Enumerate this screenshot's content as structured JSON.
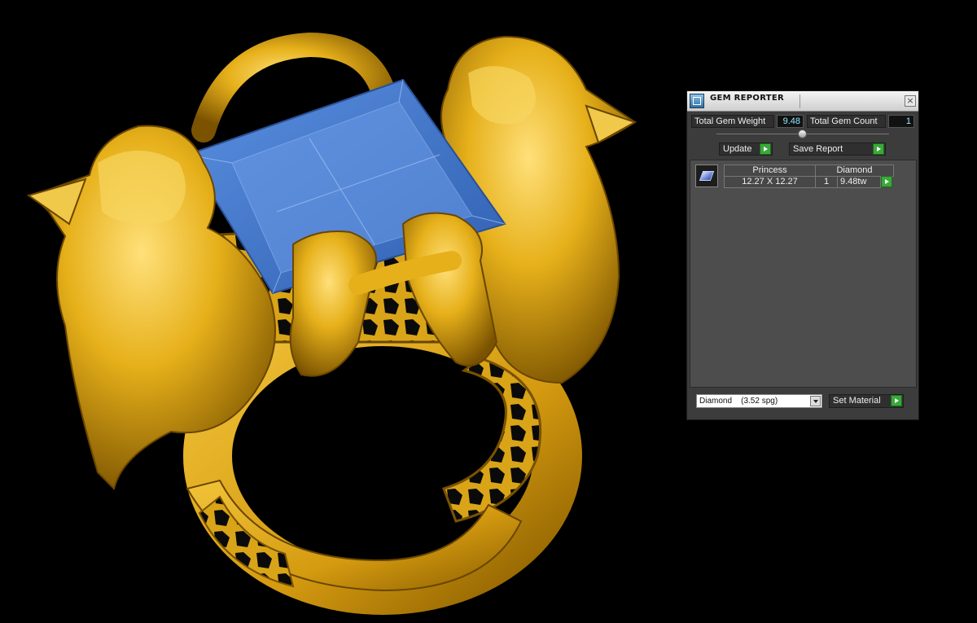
{
  "panel": {
    "title": "GEM REPORTER",
    "close_label": "×",
    "total_gem_weight_label": "Total Gem Weight",
    "total_gem_weight_value": "9.48",
    "total_gem_count_label": "Total Gem Count",
    "total_gem_count_value": "1",
    "update_label": "Update",
    "save_report_label": "Save Report",
    "table": {
      "columns": [
        "Princess",
        "Diamond"
      ],
      "rows": [
        {
          "size": "12.27 X 12.27",
          "count": "1",
          "weight": "9.48tw"
        }
      ]
    },
    "material_select": {
      "value": "Diamond    (3.52 spg)"
    },
    "set_material_label": "Set Material"
  },
  "colors": {
    "gold": "#e6b01a",
    "gem_blue": "#4a7fd0",
    "background": "#000000",
    "accent_green": "#3aa83a",
    "value_cyan": "#8fe9ff"
  }
}
